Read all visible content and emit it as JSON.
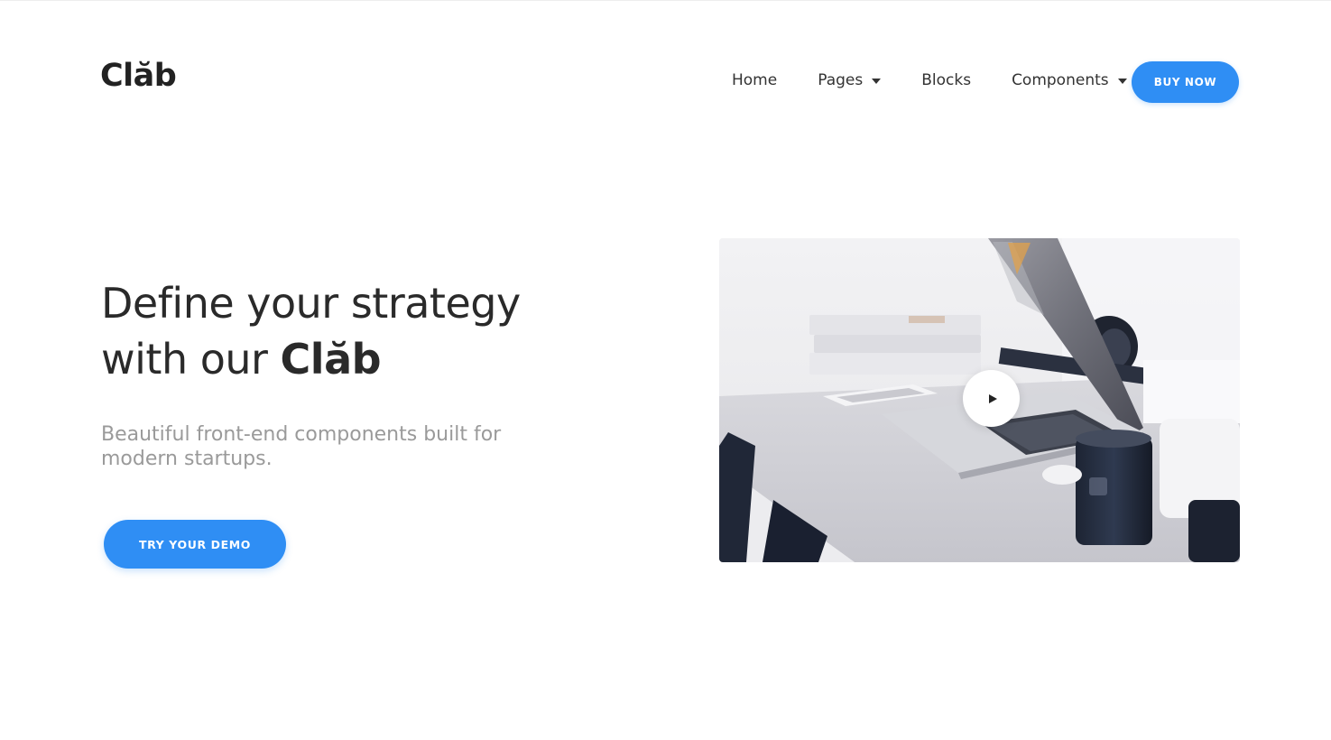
{
  "header": {
    "logo_text": "Clăb",
    "nav": {
      "home": "Home",
      "pages": "Pages",
      "blocks": "Blocks",
      "components": "Components"
    },
    "buy_now_label": "BUY NOW"
  },
  "hero": {
    "title_line1": "Define your strategy",
    "title_line2_prefix": "with our ",
    "title_brand": "Clăb",
    "subtitle": "Beautiful front-end components built for modern startups.",
    "cta_label": "TRY YOUR DEMO"
  },
  "media": {
    "image_subject": "laptop on desk",
    "play_icon": "play-icon"
  },
  "colors": {
    "accent": "#2f8ef4",
    "text": "#2a2a2a",
    "muted": "#9a9a9a",
    "background": "#ffffff"
  }
}
